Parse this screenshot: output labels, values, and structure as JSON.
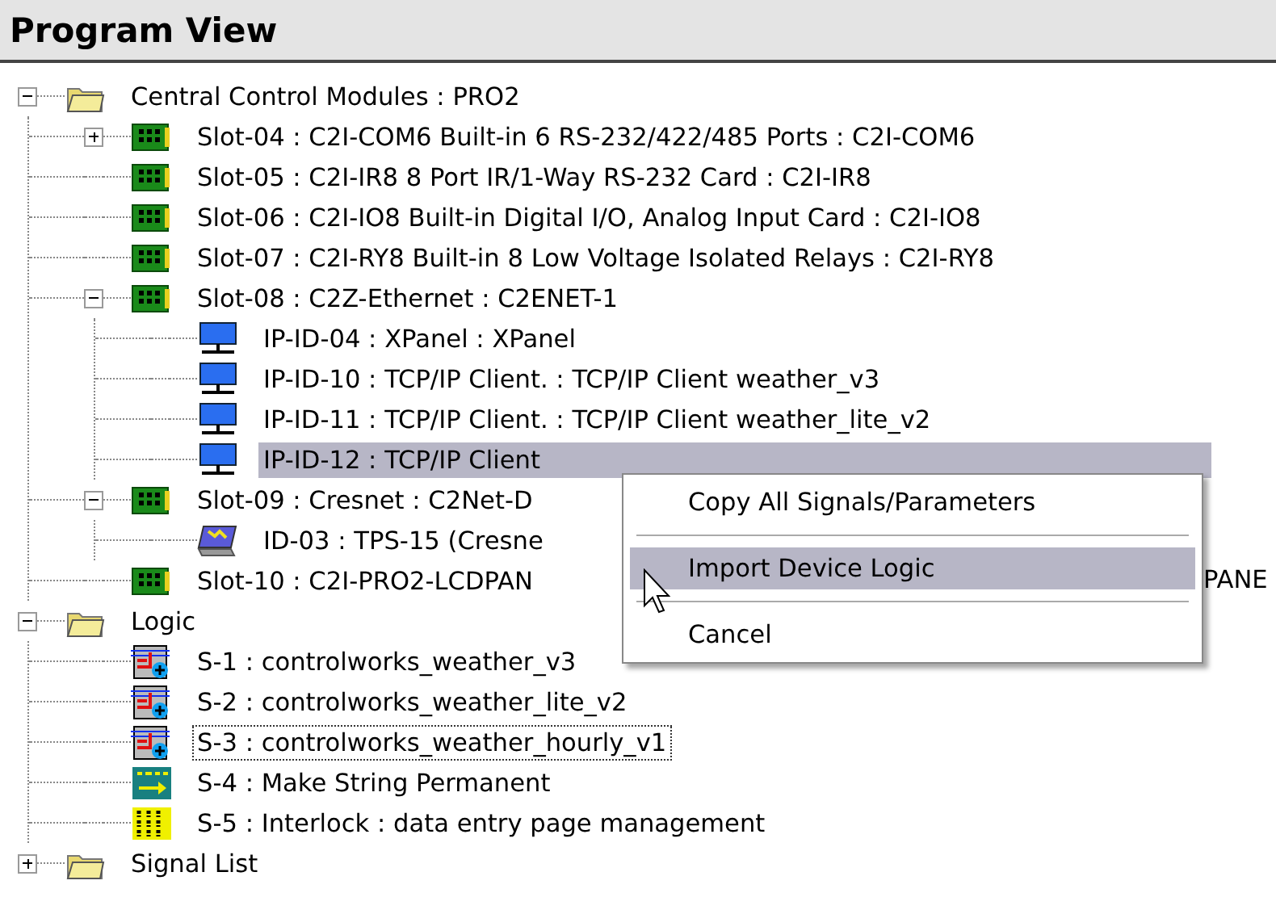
{
  "panel": {
    "title": "Program View"
  },
  "tree": [
    {
      "kind": "folder",
      "label": "Central Control Modules : PRO2",
      "expanded": true,
      "selected": false,
      "focused": false,
      "children": [
        {
          "kind": "card",
          "label": "Slot-04 : C2I-COM6 Built-in 6 RS-232/422/485 Ports : C2I-COM6",
          "expanded": false,
          "selected": false,
          "focused": false
        },
        {
          "kind": "card",
          "label": "Slot-05 : C2I-IR8 8 Port IR/1-Way RS-232 Card : C2I-IR8",
          "selected": false,
          "focused": false
        },
        {
          "kind": "card",
          "label": "Slot-06 : C2I-IO8 Built-in Digital I/O, Analog Input Card : C2I-IO8",
          "selected": false,
          "focused": false
        },
        {
          "kind": "card",
          "label": "Slot-07 : C2I-RY8 Built-in 8 Low Voltage Isolated Relays : C2I-RY8",
          "selected": false,
          "focused": false
        },
        {
          "kind": "card",
          "label": "Slot-08 : C2Z-Ethernet : C2ENET-1",
          "expanded": true,
          "selected": false,
          "focused": false,
          "children": [
            {
              "kind": "ip-device",
              "label": "IP-ID-04 : XPanel : XPanel",
              "selected": false,
              "focused": false
            },
            {
              "kind": "ip-device",
              "label": "IP-ID-10 : TCP/IP Client. : TCP/IP Client weather_v3",
              "selected": false,
              "focused": false
            },
            {
              "kind": "ip-device",
              "label": "IP-ID-11 : TCP/IP Client. : TCP/IP Client weather_lite_v2",
              "selected": false,
              "focused": false
            },
            {
              "kind": "ip-device",
              "label": "IP-ID-12 : TCP/IP Client",
              "selected": true,
              "focused": false
            }
          ]
        },
        {
          "kind": "card",
          "label": "Slot-09 : Cresnet : C2Net-D",
          "expanded": true,
          "selected": false,
          "focused": false,
          "children": [
            {
              "kind": "touchpanel",
              "label": "ID-03 : TPS-15 (Cresne",
              "selected": false,
              "focused": false
            }
          ]
        },
        {
          "kind": "card",
          "label": "Slot-10 : C2I-PRO2-LCDPAN",
          "tail": "PANE",
          "selected": false,
          "focused": false
        }
      ]
    },
    {
      "kind": "folder",
      "label": "Logic",
      "expanded": true,
      "selected": false,
      "focused": false,
      "children": [
        {
          "kind": "logic",
          "label": "S-1 : controlworks_weather_v3",
          "selected": false,
          "focused": false
        },
        {
          "kind": "logic",
          "label": "S-2 : controlworks_weather_lite_v2",
          "selected": false,
          "focused": false
        },
        {
          "kind": "logic",
          "label": "S-3 : controlworks_weather_hourly_v1",
          "selected": false,
          "focused": true
        },
        {
          "kind": "string",
          "label": "S-4 : Make String Permanent",
          "selected": false,
          "focused": false
        },
        {
          "kind": "interlock",
          "label": "S-5 : Interlock : data entry page management",
          "selected": false,
          "focused": false
        }
      ]
    },
    {
      "kind": "folder",
      "label": "Signal List",
      "expanded": false,
      "selected": false,
      "focused": false
    }
  ],
  "context_menu": [
    {
      "kind": "item",
      "label": "Copy All Signals/Parameters",
      "selected": false
    },
    {
      "kind": "separator"
    },
    {
      "kind": "item",
      "label": "Import Device Logic",
      "selected": true
    },
    {
      "kind": "separator"
    },
    {
      "kind": "item",
      "label": "Cancel",
      "selected": false
    }
  ]
}
